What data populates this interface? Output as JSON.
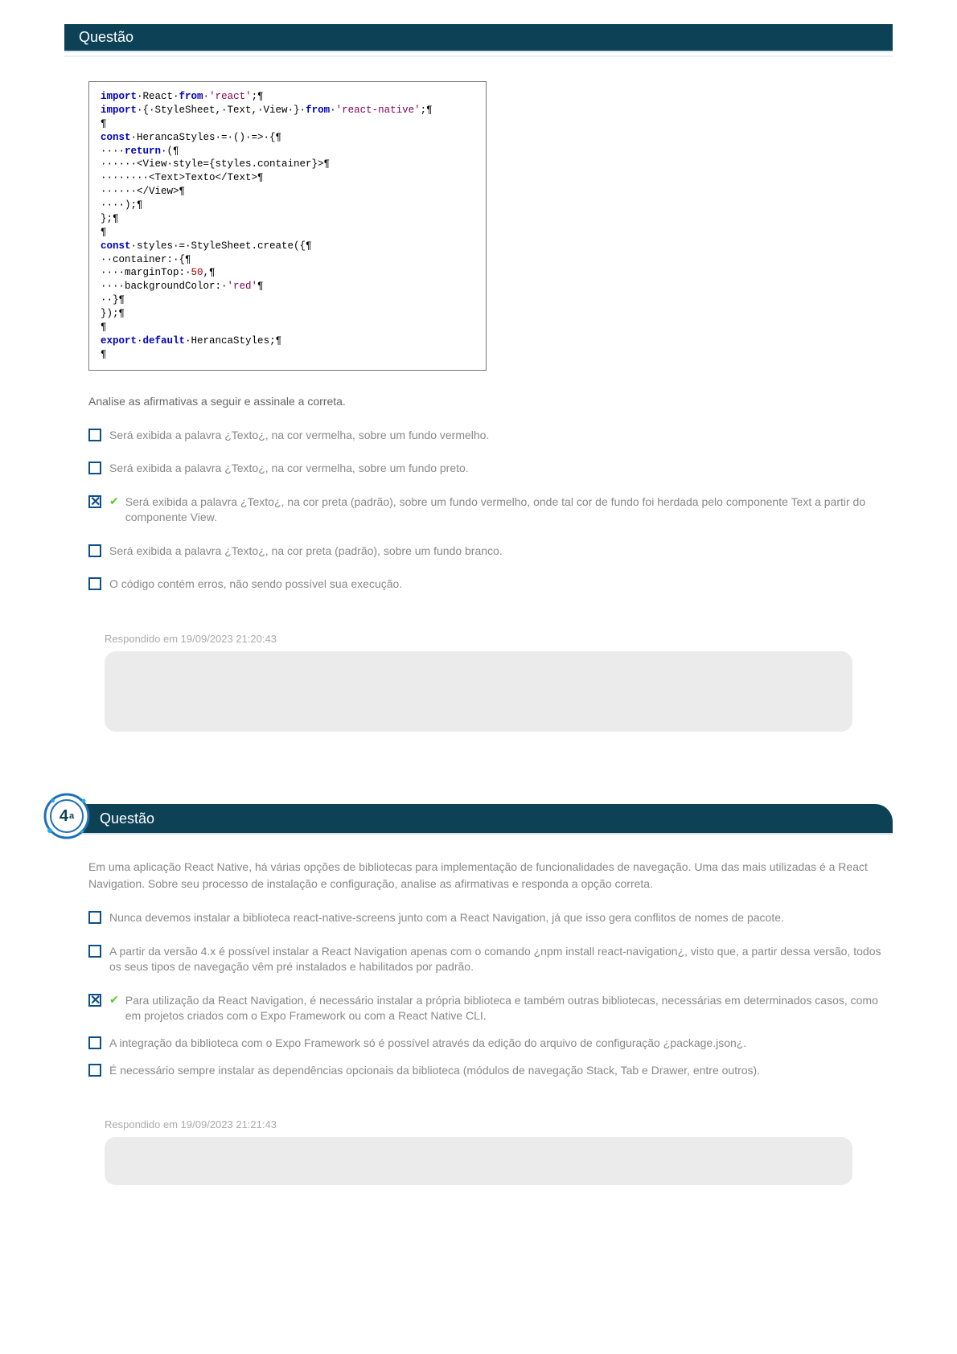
{
  "q3": {
    "header": "Questão",
    "code": {
      "l1a": "import",
      "l1b": "·React·",
      "l1c": "from",
      "l1d": "·",
      "l1e": "'react'",
      "l1f": ";¶",
      "l2a": "import",
      "l2b": "·{·StyleSheet,·Text,·View·}·",
      "l2c": "from",
      "l2d": "·",
      "l2e": "'react-native'",
      "l2f": ";¶",
      "l3": "¶",
      "l4a": "const",
      "l4b": "·HerancaStyles·=·()·=>·{¶",
      "l5a": "····",
      "l5b": "return",
      "l5c": "·(¶",
      "l6": "······<View·style={styles.container}>¶",
      "l7": "········<Text>Texto</Text>¶",
      "l8": "······</View>¶",
      "l9": "····);¶",
      "l10": "};¶",
      "l11": "¶",
      "l12a": "const",
      "l12b": "·styles·=·StyleSheet.create({¶",
      "l13": "··container:·{¶",
      "l14a": "····marginTop:·",
      "l14b": "50",
      "l14c": ",¶",
      "l15a": "····backgroundColor:·",
      "l15b": "'red'",
      "l15c": "¶",
      "l16": "··}¶",
      "l17": "});¶",
      "l18": "¶",
      "l19a": "export",
      "l19b": "·",
      "l19c": "default",
      "l19d": "·HerancaStyles;¶",
      "l20": "¶"
    },
    "prompt": "Analise as afirmativas a seguir e assinale a correta.",
    "options": [
      "Será exibida a palavra ¿Texto¿, na cor vermelha, sobre um fundo vermelho.",
      "Será exibida a palavra ¿Texto¿, na cor vermelha, sobre um fundo preto.",
      "Será exibida a palavra ¿Texto¿, na cor preta (padrão), sobre um fundo vermelho, onde tal cor de fundo foi herdada pelo componente Text a partir do componente View.",
      "Será exibida a palavra ¿Texto¿, na cor preta (padrão), sobre um fundo branco.",
      "O código contém erros, não sendo possível sua execução."
    ],
    "correct_index": 2,
    "answer_label": "Respondido em 19/09/2023 21:20:43"
  },
  "q4": {
    "number": "4",
    "ord": "a",
    "header": "Questão",
    "intro": "Em uma aplicação React Native, há várias opções de bibliotecas para implementação de funcionalidades de navegação. Uma das mais utilizadas é a React Navigation. Sobre seu processo de instalação e configuração, analise as afirmativas e responda a opção correta.",
    "options": [
      "Nunca devemos instalar a biblioteca react-native-screens junto com a React Navigation, já que isso gera conflitos de nomes de pacote.",
      "A partir da versão 4.x é possível instalar a React Navigation apenas com o comando ¿npm install react-navigation¿, visto que, a partir dessa versão, todos os seus tipos de navegação vêm pré instalados e habilitados por padrão.",
      "Para utilização da React Navigation, é necessário instalar a própria biblioteca e também outras bibliotecas, necessárias em determinados casos, como em projetos criados com o Expo Framework ou com a React Native CLI.",
      "A integração da biblioteca com o Expo Framework só é possível através da edição do arquivo de configuração ¿package.json¿.",
      "É necessário sempre instalar as dependências opcionais da biblioteca (módulos de navegação Stack, Tab e Drawer, entre outros)."
    ],
    "correct_index": 2,
    "answer_label": "Respondido em 19/09/2023 21:21:43"
  }
}
